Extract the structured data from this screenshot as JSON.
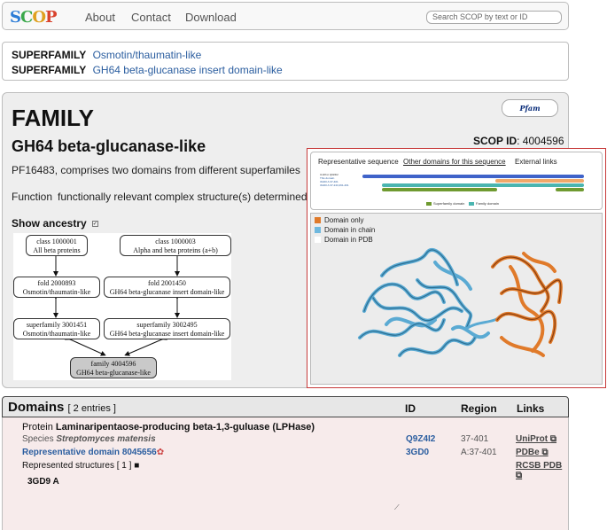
{
  "nav": {
    "logo": "SCOP",
    "links": [
      "About",
      "Contact",
      "Download"
    ],
    "search_placeholder": "Search SCOP by text or ID"
  },
  "superfamilies": [
    {
      "label": "SUPERFAMILY",
      "name": "Osmotin/thaumatin-like"
    },
    {
      "label": "SUPERFAMILY",
      "name": "GH64 beta-glucanase insert domain-like"
    }
  ],
  "family": {
    "level": "FAMILY",
    "pfam_button": "Pfam",
    "name": "GH64 beta-glucanase-like",
    "scop_id_label": "SCOP ID",
    "scop_id": "4004596",
    "description": "PF16483, comprises two domains from different superfamiles",
    "function_label": "Function",
    "function_text": "functionally relevant complex structure(s) determined",
    "ancestry_label": "Show ancestry"
  },
  "ancestry_graph": {
    "class_a": [
      "class 1000001",
      "All beta proteins"
    ],
    "class_b": [
      "class 1000003",
      "Alpha and beta proteins (a+b)"
    ],
    "fold_a": [
      "fold 2000893",
      "Osmotin/thaumatin-like"
    ],
    "fold_b": [
      "fold 2001450",
      "GH64 beta-glucanase insert domain-like"
    ],
    "sf_a": [
      "superfamily 3001451",
      "Osmotin/thaumatin-like"
    ],
    "sf_b": [
      "superfamily 3002495",
      "GH64 beta-glucanase insert domain-like"
    ],
    "fam": [
      "family 4004596",
      "GH64 beta-glucanase-like"
    ]
  },
  "viewer": {
    "tabs": [
      "Representative sequence",
      "Other domains for this sequence",
      "External links"
    ],
    "active_tab": 1,
    "seq_labels": [
      "UniProt Q9Z4I2",
      "This domain",
      "3GD0 A:37-401",
      "3GD0 A:37-243,291-401"
    ],
    "small_legend": [
      "Superfamily domain",
      "Family domain"
    ],
    "legend": [
      "Domain only",
      "Domain in chain",
      "Domain in PDB"
    ],
    "colors": {
      "domain_only": "#e07a2a",
      "domain_in_chain": "#6fb8de",
      "domain_in_pdb": "#ffffff",
      "bar_blue": "#3f63c9",
      "bar_orange": "#f0a86a",
      "bar_teal": "#4ab5b0",
      "bar_green": "#6f9a30",
      "frame": "#c73b3b"
    }
  },
  "domains": {
    "title": "Domains",
    "count": "[ 2 entries ]",
    "columns": [
      "ID",
      "Region",
      "Links"
    ],
    "protein_label": "Protein",
    "protein_name": "Laminaripentaose-producing beta-1,3-guluase (LPHase)",
    "species_label": "Species",
    "species_name": "Streptomyces matensis",
    "uniprot_id": "Q9Z4I2",
    "uniprot_region": "37-401",
    "rep_domain_label": "Representative domain 8045656",
    "rep_id": "3GD0",
    "rep_region": "A:37-401",
    "represented_structures": "Represented structures [ 1 ]",
    "structure": "3GD9 A",
    "links": [
      "UniProt",
      "PDBe",
      "RCSB PDB"
    ]
  }
}
